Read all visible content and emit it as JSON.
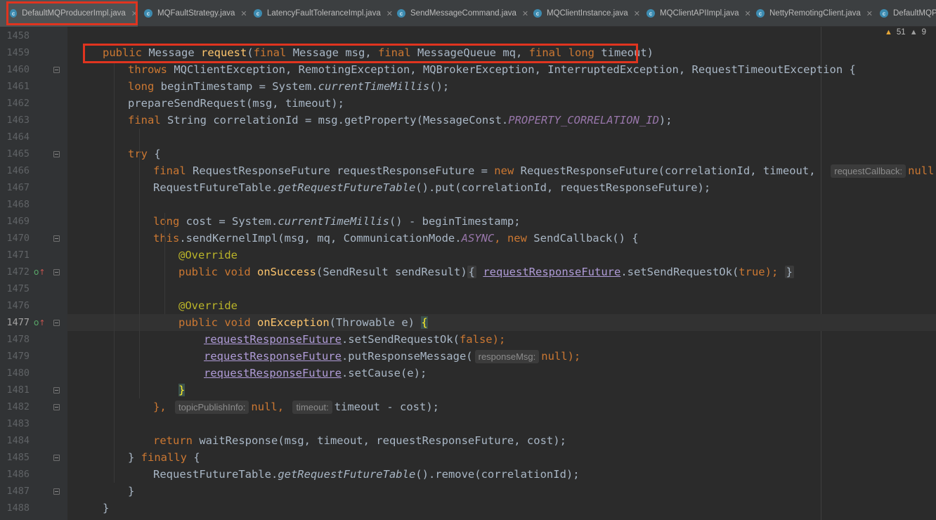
{
  "tabs": [
    {
      "label": "DefaultMQProducerImpl.java",
      "active": true
    },
    {
      "label": "MQFaultStrategy.java"
    },
    {
      "label": "LatencyFaultToleranceImpl.java"
    },
    {
      "label": "SendMessageCommand.java"
    },
    {
      "label": "MQClientInstance.java"
    },
    {
      "label": "MQClientAPIImpl.java"
    },
    {
      "label": "NettyRemotingClient.java"
    },
    {
      "label": "DefaultMQPr"
    }
  ],
  "warnings": {
    "warning_count": "51",
    "weak_warning_count": "9"
  },
  "current_line": "1477",
  "line_numbers": [
    "1458",
    "1459",
    "1460",
    "1461",
    "1462",
    "1463",
    "1464",
    "1465",
    "1466",
    "1467",
    "1468",
    "1469",
    "1470",
    "1471",
    "1472",
    "1475",
    "1476",
    "1477",
    "1478",
    "1479",
    "1480",
    "1481",
    "1482",
    "1483",
    "1484",
    "1485",
    "1486",
    "1487",
    "1488"
  ],
  "code": {
    "l1459": [
      "public",
      " ",
      "Message",
      " ",
      "request",
      "(",
      "final",
      " Message msg, ",
      "final",
      " MessageQueue mq, ",
      "final",
      " ",
      "long",
      " timeout)"
    ],
    "l1460": [
      "throws",
      " MQClientException, RemotingException, MQBrokerException, InterruptedException, RequestTimeoutException {"
    ],
    "l1461": [
      "long",
      " beginTimestamp = System.",
      "currentTimeMillis",
      "();"
    ],
    "l1462": [
      "prepareSendRequest(msg, timeout);"
    ],
    "l1463": [
      "final",
      " String correlationId = msg.getProperty(MessageConst.",
      "PROPERTY_CORRELATION_ID",
      ");"
    ],
    "l1465": [
      "try",
      " {"
    ],
    "l1466": [
      "final",
      " RequestResponseFuture requestResponseFuture = ",
      "new",
      " RequestResponseFuture(correlationId, timeout, ",
      "requestCallback:",
      "null",
      ");"
    ],
    "l1467": [
      "RequestFutureTable.",
      "getRequestFutureTable",
      "().put(correlationId, requestResponseFuture);"
    ],
    "l1469": [
      "long",
      " cost = System.",
      "currentTimeMillis",
      "() - beginTimestamp;"
    ],
    "l1470": [
      "this",
      ".sendKernelImpl(msg, mq, CommunicationMode.",
      "ASYNC",
      ", ",
      "new",
      " SendCallback() {"
    ],
    "l1471": [
      "@Override"
    ],
    "l1472": [
      "public",
      " ",
      "void",
      " ",
      "onSuccess",
      "(SendResult sendResult)",
      "{",
      "requestResponseFuture",
      ".setSendRequestOk(",
      "true",
      ");",
      "}"
    ],
    "l1476": [
      "@Override"
    ],
    "l1477": [
      "public",
      " ",
      "void",
      " ",
      "onException",
      "(Throwable e) ",
      "{"
    ],
    "l1478": [
      "requestResponseFuture",
      ".setSendRequestOk(",
      "false",
      ");"
    ],
    "l1479": [
      "requestResponseFuture",
      ".putResponseMessage(",
      "responseMsg:",
      "null",
      ");"
    ],
    "l1480": [
      "requestResponseFuture",
      ".setCause(e);"
    ],
    "l1481": [
      "}"
    ],
    "l1482": [
      "},",
      "topicPublishInfo:",
      "null",
      ",",
      "timeout:",
      "timeout - cost);"
    ],
    "l1484": [
      "return",
      " waitResponse(msg, timeout, requestResponseFuture, cost);"
    ],
    "l1485": [
      "} ",
      "finally",
      " {"
    ],
    "l1486": [
      "RequestFutureTable.",
      "getRequestFutureTable",
      "().remove(correlationId);"
    ],
    "l1487": [
      "}"
    ],
    "l1488": [
      "}"
    ]
  },
  "colors": {
    "keyword": "#cc7832",
    "method": "#ffc66d",
    "constant": "#9876aa",
    "annotation": "#bbb529",
    "highlight_box": "#e0341f"
  },
  "icons": {
    "tab_file_icon": "java-class-icon",
    "gutter_icon": "override-implements-icon",
    "warning_icon": "warning-triangle-icon"
  }
}
